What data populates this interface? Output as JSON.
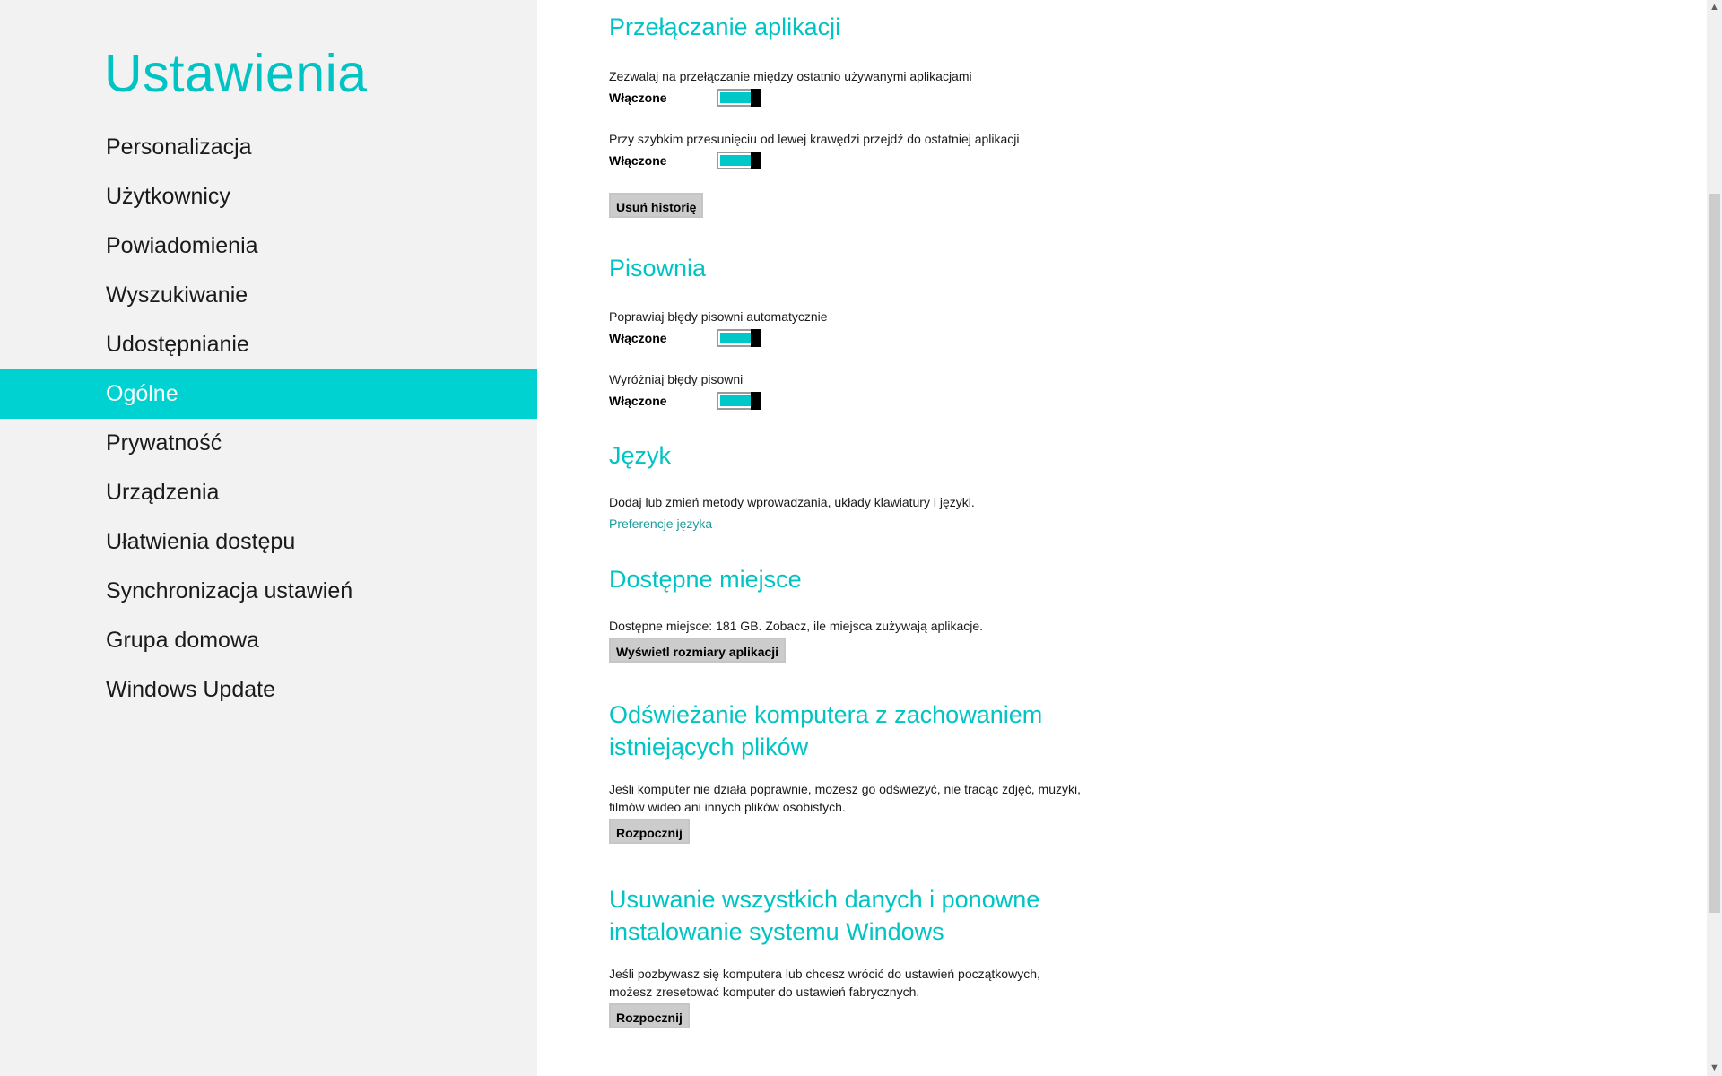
{
  "app": {
    "title": "Ustawienia"
  },
  "nav": {
    "items": [
      {
        "label": "Personalizacja"
      },
      {
        "label": "Użytkownicy"
      },
      {
        "label": "Powiadomienia"
      },
      {
        "label": "Wyszukiwanie"
      },
      {
        "label": "Udostępnianie"
      },
      {
        "label": "Ogólne",
        "selected": true
      },
      {
        "label": "Prywatność"
      },
      {
        "label": "Urządzenia"
      },
      {
        "label": "Ułatwienia dostępu"
      },
      {
        "label": "Synchronizacja ustawień"
      },
      {
        "label": "Grupa domowa"
      },
      {
        "label": "Windows Update"
      }
    ]
  },
  "app_switching": {
    "title": "Przełączanie aplikacji",
    "allow_switch": {
      "label": "Zezwalaj na przełączanie między ostatnio używanymi aplikacjami",
      "state": "Włączone",
      "on": true
    },
    "swipe_switch": {
      "label": "Przy szybkim przesunięciu od lewej krawędzi przejdź do ostatniej aplikacji",
      "state": "Włączone",
      "on": true
    },
    "clear_history_button": "Usuń historię"
  },
  "spelling": {
    "title": "Pisownia",
    "autocorrect": {
      "label": "Poprawiaj błędy pisowni automatycznie",
      "state": "Włączone",
      "on": true
    },
    "highlight": {
      "label": "Wyróżniaj błędy pisowni",
      "state": "Włączone",
      "on": true
    }
  },
  "language": {
    "title": "Język",
    "desc": "Dodaj lub zmień metody wprowadzania, układy klawiatury i języki.",
    "link": "Preferencje języka"
  },
  "storage": {
    "title": "Dostępne miejsce",
    "desc": "Dostępne miejsce: 181 GB. Zobacz, ile miejsca zużywają aplikacje.",
    "button": "Wyświetl rozmiary aplikacji"
  },
  "refresh": {
    "title_line1": "Odświeżanie komputera z zachowaniem",
    "title_line2": "istniejących plików",
    "desc_line1": "Jeśli komputer nie działa poprawnie, możesz go odświeżyć, nie tracąc zdjęć, muzyki,",
    "desc_line2": "filmów wideo ani innych plików osobistych.",
    "button": "Rozpocznij"
  },
  "reset": {
    "title_line1": "Usuwanie wszystkich danych i ponowne",
    "title_line2": "instalowanie systemu Windows",
    "desc_line1": "Jeśli pozbywasz się komputera lub chcesz wrócić do ustawień początkowych,",
    "desc_line2": "możesz zresetować komputer do ustawień fabrycznych.",
    "button": "Rozpocznij"
  },
  "scrollbar": {
    "up_icon": "chevron-up-icon",
    "down_icon": "chevron-down-icon"
  },
  "colors": {
    "accent": "#00c4c4",
    "selected_bg": "#00d2d2",
    "sidebar_bg": "#f2f2f2",
    "button_bg": "#cccccc"
  }
}
